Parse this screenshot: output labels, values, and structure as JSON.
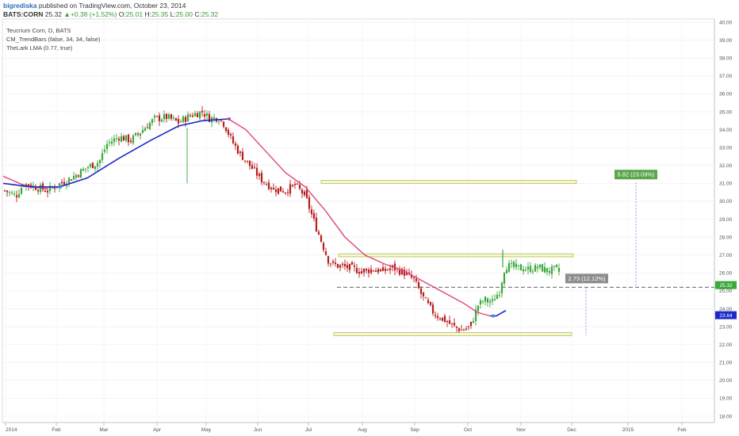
{
  "header": {
    "author": "bigrediska",
    "published": "published on TradingView.com, October 23, 2014",
    "symbol": "BATS:CORN",
    "last": "25.32",
    "change": "▲+0.38 (+1.52%)",
    "o_label": "O:",
    "o_value": "25.01",
    "h_label": "H:",
    "h_value": "25.35",
    "l_label": "L:",
    "l_value": "25.00",
    "c_label": "C:",
    "c_value": "25.32"
  },
  "chart_data": {
    "type": "candlestick",
    "legend": [
      "Teucrium Corn, D, BATS",
      "CM_TrendBars (false, 34, 34, false)",
      "TheLark LMA (0.77, true)"
    ],
    "x_ticks": [
      "2014",
      "Feb",
      "Mar",
      "Apr",
      "May",
      "Jun",
      "Jul",
      "Aug",
      "Sep",
      "Oct",
      "Nov",
      "Dec",
      "2015",
      "Feb"
    ],
    "y_ticks": [
      "18.00",
      "19.00",
      "20.00",
      "21.00",
      "22.00",
      "23.00",
      "24.00",
      "25.00",
      "26.00",
      "27.00",
      "28.00",
      "29.00",
      "30.00",
      "31.00",
      "32.00",
      "33.00",
      "34.00",
      "35.00",
      "36.00",
      "37.00",
      "38.00",
      "39.00",
      "40.00"
    ],
    "ylim": [
      17.6,
      40.4
    ],
    "price_label_green": "25.32",
    "price_label_blue": "23.64",
    "annotations": [
      {
        "text": "5.82 (23.09%)",
        "color": "#5aa64a"
      },
      {
        "text": "2.73 (12.12%)",
        "color": "#8c8c8c"
      }
    ],
    "colors": {
      "up": "#3aa83a",
      "down": "#b81c1c",
      "lma_blue": "#1c28c8",
      "lma_pink": "#e0457a",
      "zone": "#b5bd3e"
    },
    "key_points": [
      {
        "date": "2014-01-02",
        "close": 30.7
      },
      {
        "date": "2014-04-28",
        "close": 34.9
      },
      {
        "date": "2014-07-18",
        "close": 26.2
      },
      {
        "date": "2014-09-30",
        "close": 22.8
      },
      {
        "date": "2014-10-23",
        "close": 25.32
      }
    ],
    "zones": [
      {
        "from": 31.0,
        "to": 31.1
      },
      {
        "from": 26.9,
        "to": 27.0
      },
      {
        "from": 22.5,
        "to": 22.6
      }
    ],
    "dashed_level": 25.2
  }
}
